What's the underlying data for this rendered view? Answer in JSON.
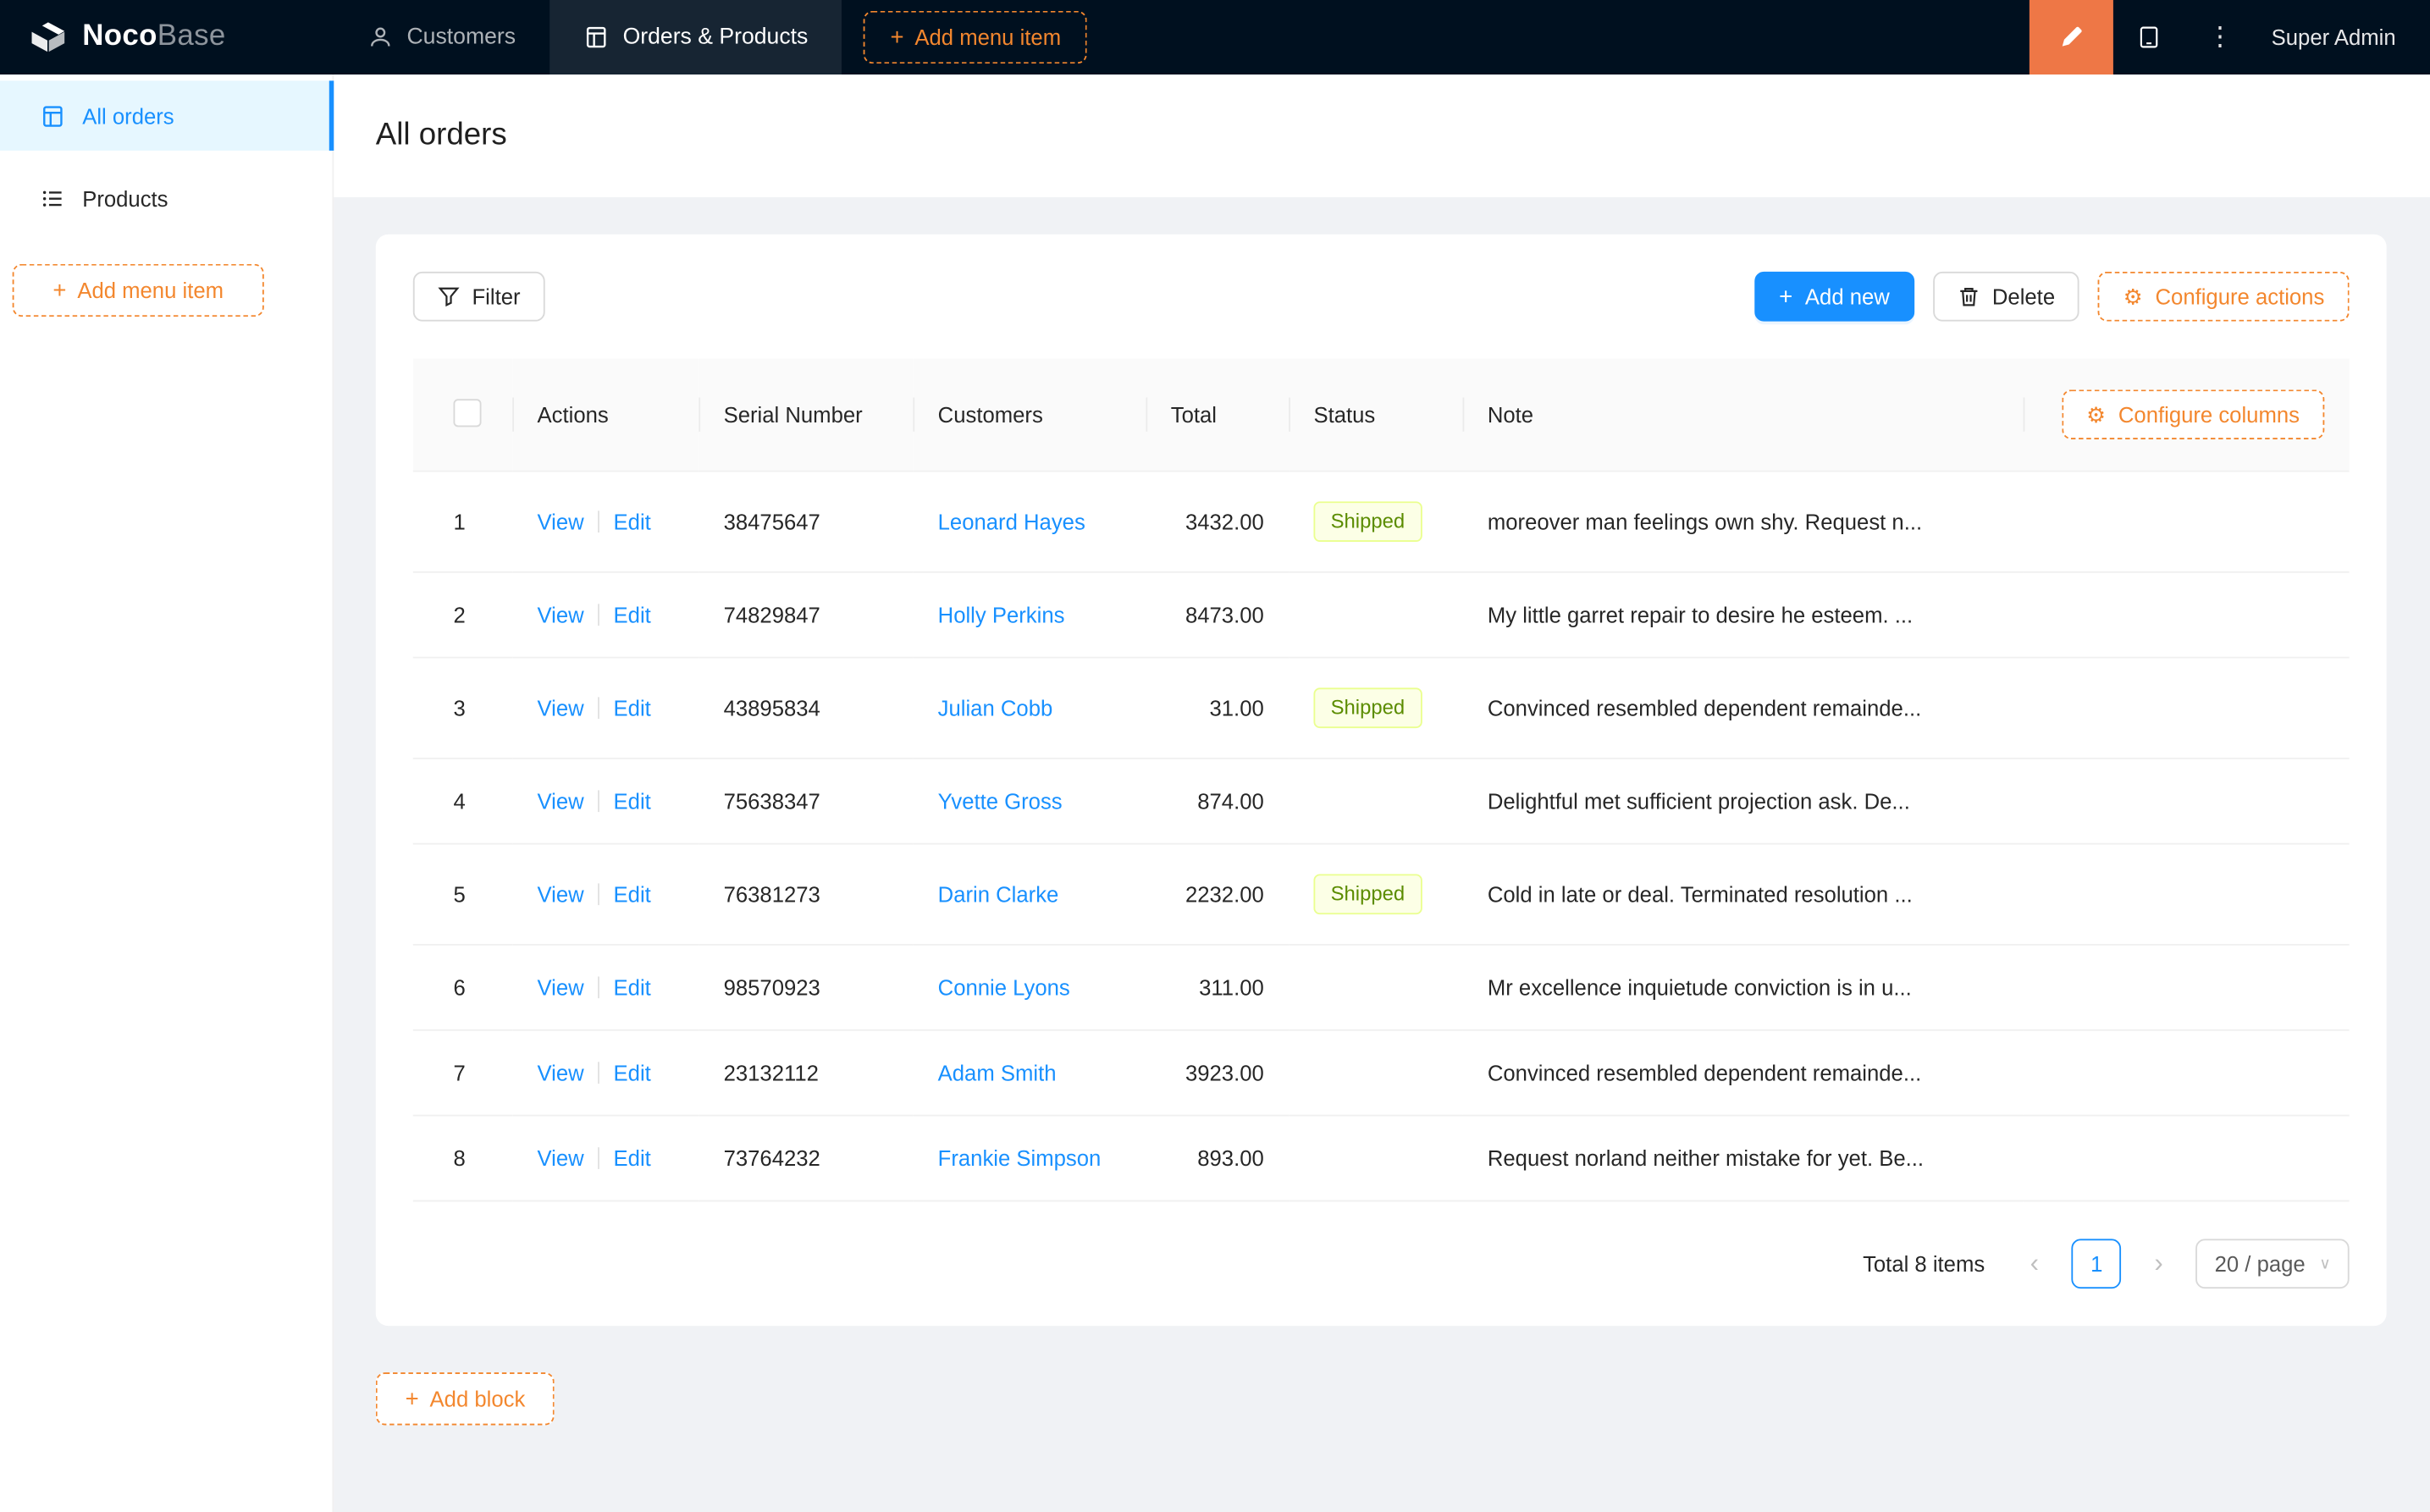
{
  "navbar": {
    "logo": {
      "noco": "Noco",
      "base": "Base"
    },
    "items": [
      {
        "label": "Customers"
      },
      {
        "label": "Orders & Products"
      }
    ],
    "add_menu_item": "Add menu item",
    "user": "Super Admin"
  },
  "sidebar": {
    "items": [
      {
        "label": "All orders"
      },
      {
        "label": "Products"
      }
    ],
    "add_menu_item": "Add menu item"
  },
  "page": {
    "title": "All orders"
  },
  "toolbar": {
    "filter": "Filter",
    "add_new": "Add new",
    "delete": "Delete",
    "configure_actions": "Configure actions"
  },
  "table": {
    "configure_columns": "Configure columns",
    "columns": [
      "Actions",
      "Serial Number",
      "Customers",
      "Total",
      "Status",
      "Note"
    ],
    "action_labels": {
      "view": "View",
      "edit": "Edit"
    },
    "rows": [
      {
        "index": "1",
        "serial": "38475647",
        "customer": "Leonard Hayes",
        "total": "3432.00",
        "status": "Shipped",
        "note": "moreover man feelings own shy. Request n..."
      },
      {
        "index": "2",
        "serial": "74829847",
        "customer": "Holly Perkins",
        "total": "8473.00",
        "status": "",
        "note": "My little garret repair to desire he esteem. ..."
      },
      {
        "index": "3",
        "serial": "43895834",
        "customer": "Julian Cobb",
        "total": "31.00",
        "status": "Shipped",
        "note": "Convinced resembled dependent remainde..."
      },
      {
        "index": "4",
        "serial": "75638347",
        "customer": "Yvette Gross",
        "total": "874.00",
        "status": "",
        "note": "Delightful met sufficient projection ask. De..."
      },
      {
        "index": "5",
        "serial": "76381273",
        "customer": "Darin Clarke",
        "total": "2232.00",
        "status": "Shipped",
        "note": "Cold in late or deal. Terminated resolution ..."
      },
      {
        "index": "6",
        "serial": "98570923",
        "customer": "Connie Lyons",
        "total": "311.00",
        "status": "",
        "note": "Mr excellence inquietude conviction is in u..."
      },
      {
        "index": "7",
        "serial": "23132112",
        "customer": "Adam Smith",
        "total": "3923.00",
        "status": "",
        "note": "Convinced resembled dependent remainde..."
      },
      {
        "index": "8",
        "serial": "73764232",
        "customer": "Frankie Simpson",
        "total": "893.00",
        "status": "",
        "note": "Request norland neither mistake for yet. Be..."
      }
    ]
  },
  "pagination": {
    "total": "Total 8 items",
    "page": "1",
    "page_size": "20 / page"
  },
  "add_block": "Add block",
  "icons": {
    "plus": "+",
    "gear": "⚙",
    "ellipsis": "⋮",
    "prev": "‹",
    "next": "›",
    "chevron_down": "∨"
  },
  "colors": {
    "navbar_bg": "#00101f",
    "accent_orange": "#f3872e",
    "designer_orange": "#ee7746",
    "primary_blue": "#1890ff",
    "link_blue": "#1890ff",
    "sidebar_active_bg": "#e6f7ff",
    "page_bg": "#f0f2f5",
    "table_header_bg": "#fafafa",
    "border_color": "#f0f0f0",
    "tag_bg": "#fcffe6",
    "tag_border": "#eaff8f",
    "tag_text": "#5b8c00"
  }
}
